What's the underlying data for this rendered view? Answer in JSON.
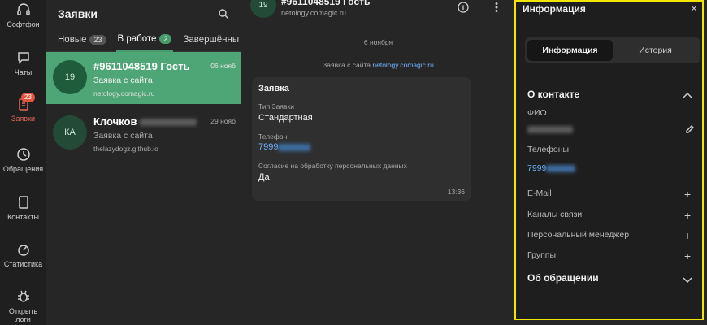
{
  "rail": {
    "items": [
      {
        "label": "Софтфон",
        "icon": "headset-icon"
      },
      {
        "label": "Чаты",
        "icon": "chat-icon"
      },
      {
        "label": "Заявки",
        "icon": "requests-icon",
        "badge": "23"
      },
      {
        "label": "Обращения",
        "icon": "clock-icon"
      },
      {
        "label": "Контакты",
        "icon": "contacts-icon"
      },
      {
        "label": "Статистика",
        "icon": "stats-icon"
      },
      {
        "label": "Открыть",
        "label2": "логи",
        "icon": "bug-icon"
      }
    ]
  },
  "list": {
    "title": "Заявки",
    "tabs": [
      {
        "label": "Новые",
        "count": "23"
      },
      {
        "label": "В работе",
        "count": "2"
      },
      {
        "label": "Завершённы"
      }
    ],
    "items": [
      {
        "avatar": "19",
        "name": "#9611048519 Гость",
        "date": "06 нояб",
        "subtitle": "Заявка с сайта",
        "site": "netology.comagic.ru"
      },
      {
        "avatar": "КА",
        "name": "Клочков",
        "date": "29 нояб",
        "subtitle": "Заявка с сайта",
        "site": "thelazydogz.github.io"
      }
    ]
  },
  "chat": {
    "avatar": "19",
    "name": "#9611048519 Гость",
    "site": "netology.comagic.ru",
    "day": "6 ноября",
    "system_prefix": "Заявка с сайта",
    "system_link": "netology.comagic.ru",
    "card": {
      "title": "Заявка",
      "type_label": "Тип Заявки",
      "type_value": "Стандартная",
      "phone_label": "Телефон",
      "phone_value": "7999",
      "consent_label": "Согласие на обработку персональных данных",
      "consent_value": "Да",
      "time": "13:36"
    }
  },
  "info": {
    "title": "Информация",
    "close": "×",
    "tabs": [
      "Информация",
      "История"
    ],
    "contact_title": "О контакте",
    "fio_label": "ФИО",
    "phones_label": "Телефоны",
    "phone_value": "7999",
    "email_label": "E-Mail",
    "channels_label": "Каналы связи",
    "manager_label": "Персональный менеджер",
    "groups_label": "Группы",
    "about_title": "Об обращении",
    "plus": "+"
  },
  "colors": {
    "accent": "#4ea575",
    "highlight": "#f2e600",
    "link": "#6fb3ff",
    "badge": "#e0553f"
  }
}
